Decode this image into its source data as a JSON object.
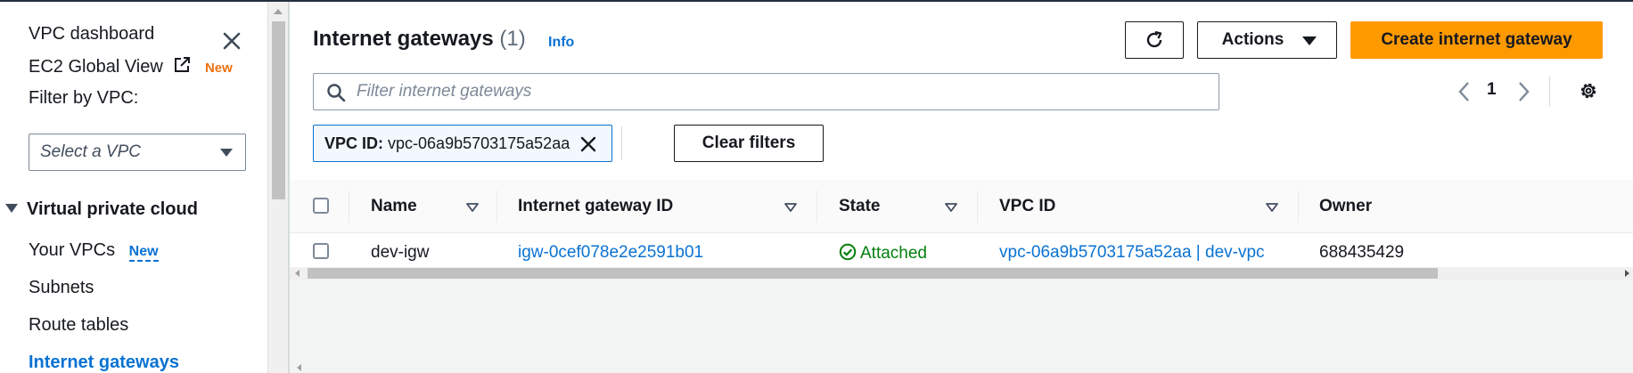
{
  "sidebar": {
    "vpc_dashboard": "VPC dashboard",
    "ec2_global_view": "EC2 Global View",
    "ec2_global_view_badge": "New",
    "filter_label": "Filter by VPC:",
    "vpc_select_placeholder": "Select a VPC",
    "section_title": "Virtual private cloud",
    "items": [
      {
        "label": "Your VPCs",
        "badge": "New"
      },
      {
        "label": "Subnets"
      },
      {
        "label": "Route tables"
      },
      {
        "label": "Internet gateways",
        "active": true
      }
    ]
  },
  "header": {
    "title": "Internet gateways",
    "count": "(1)",
    "info": "Info",
    "actions_label": "Actions",
    "create_label": "Create internet gateway"
  },
  "search": {
    "placeholder": "Filter internet gateways"
  },
  "pagination": {
    "current_page": "1"
  },
  "filter_token": {
    "key": "VPC ID:",
    "value": "vpc-06a9b5703175a52aa"
  },
  "clear_filters_label": "Clear filters",
  "table": {
    "columns": [
      "Name",
      "Internet gateway ID",
      "State",
      "VPC ID",
      "Owner"
    ],
    "rows": [
      {
        "name": "dev-igw",
        "gateway_id": "igw-0cef078e2e2591b01",
        "state": "Attached",
        "vpc_id": "vpc-06a9b5703175a52aa | dev-vpc",
        "owner": "688435429"
      }
    ]
  },
  "colors": {
    "primary_button": "#ff9900",
    "link": "#0972d3",
    "success": "#037f0c",
    "new_badge": "#ec7211"
  },
  "icons": [
    "close-icon",
    "external-link-icon",
    "caret-down-icon",
    "refresh-icon",
    "search-icon",
    "chevron-left-icon",
    "chevron-right-icon",
    "gear-icon",
    "dismiss-icon",
    "sort-icon",
    "status-success-icon"
  ]
}
